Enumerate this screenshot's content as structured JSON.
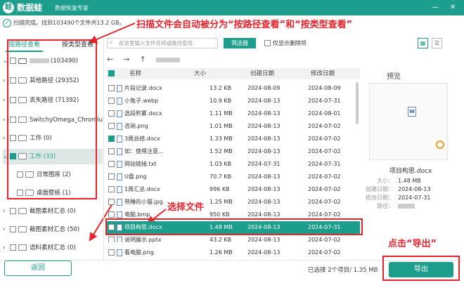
{
  "app": {
    "logo_char": "蛙",
    "name": "数据蛙",
    "subtitle": "数据恢复专家",
    "minimize": "—",
    "close": "✕"
  },
  "status": {
    "check": "✓",
    "text": "扫描完成。找到103490个文件共13.2 GB。"
  },
  "annotations": {
    "top": "扫描文件会自动被分为“按路径查看”和“按类型查看”",
    "select": "选择文件",
    "export": "点击“导出”"
  },
  "left_tabs": {
    "by_path": "按路径查看",
    "by_type": "按类型查看"
  },
  "tree": {
    "root": {
      "count": "(103490)"
    },
    "items": [
      {
        "label": "其他路径 (29352)"
      },
      {
        "label": "丢失路径 (71392)"
      },
      {
        "label": "SwitchyOmega_Chromium"
      },
      {
        "label": "工作 (0)"
      },
      {
        "label": "工作 (33)"
      },
      {
        "label": "日常图库 (2)"
      },
      {
        "label": "桌面壁纸 (1)"
      },
      {
        "label": "截图素材汇总 (0)"
      },
      {
        "label": "截图素材汇总 (50)"
      },
      {
        "label": "语料素材汇总 (0)"
      }
    ]
  },
  "toolbar": {
    "search_placeholder": "在这里输入文件名称或路径查找",
    "filter_label": "筛选器",
    "deleted_only": "仅显示删除项",
    "view_grid_icon": "▦",
    "view_list_icon": "☰"
  },
  "nav": {
    "back": "←",
    "forward": "→",
    "up": "↑"
  },
  "table": {
    "headers": {
      "name": "名称",
      "size": "大小",
      "created": "创建日期",
      "modified": "修改日期"
    },
    "rows": [
      {
        "name": "片段记录.docx",
        "size": "13.2 KB",
        "created": "2024-08-09",
        "modified": "2024-08-09"
      },
      {
        "name": "小兔子.webp",
        "size": "10.9 KB",
        "created": "2024-08-13",
        "modified": "2024-07-31"
      },
      {
        "name": "选段积累.docx",
        "size": "1.11 MB",
        "created": "2024-08-13",
        "modified": "2024-08-01"
      },
      {
        "name": "咨询.png",
        "size": "1.01 MB",
        "created": "2024-08-13",
        "modified": "2024-07-02"
      },
      {
        "name": "3周总结.docx",
        "size": "1.33 MB",
        "created": "2024-08-13",
        "modified": "2024-07-02"
      },
      {
        "name": "如：使用注意...",
        "size": "1.52 MB",
        "created": "2024-08-13",
        "modified": "2024-07-02"
      },
      {
        "name": "网站链接.txt",
        "size": "1.03 KB",
        "created": "2024-07-31",
        "modified": "2024-07-31"
      },
      {
        "name": "U盘.png",
        "size": "70.7 KB",
        "created": "2024-08-13",
        "modified": "2024-07-02"
      },
      {
        "name": "1周汇总.docx",
        "size": "996 KB",
        "created": "2024-08-13",
        "modified": "2024-07-02"
      },
      {
        "name": "熟睡的小猫.jpg",
        "size": "1.25 MB",
        "created": "2024-08-13",
        "modified": "2024-07-02"
      },
      {
        "name": "电脑.bmp",
        "size": "950 KB",
        "created": "2024-08-13",
        "modified": "2024-07-02"
      },
      {
        "name": "项目构思.docx",
        "size": "1.48 MB",
        "created": "2024-08-13",
        "modified": "2024-07-31"
      },
      {
        "name": "说明展示.pptx",
        "size": "43.2 KB",
        "created": "2024-08-13",
        "modified": "2024-07-02"
      },
      {
        "name": "看电脑.png",
        "size": "1.26 MB",
        "created": "2024-08-13",
        "modified": "2024-07-02"
      }
    ]
  },
  "preview": {
    "title": "预览",
    "doc_glyph": "W",
    "filename": "项目构思.docx",
    "size_label": "大小：",
    "size": "1.48 MB",
    "created_label": "创建日期：",
    "created": "2024-08-13",
    "modified_label": "修改日期：",
    "modified": "2024-07-31",
    "path_label": "路径："
  },
  "footer": {
    "back": "返回",
    "selected": "已选择 2个项目/ 1.35 MB",
    "export": "导出"
  },
  "colors": {
    "accent": "#1d9e8c",
    "annotation": "#e8232c"
  }
}
